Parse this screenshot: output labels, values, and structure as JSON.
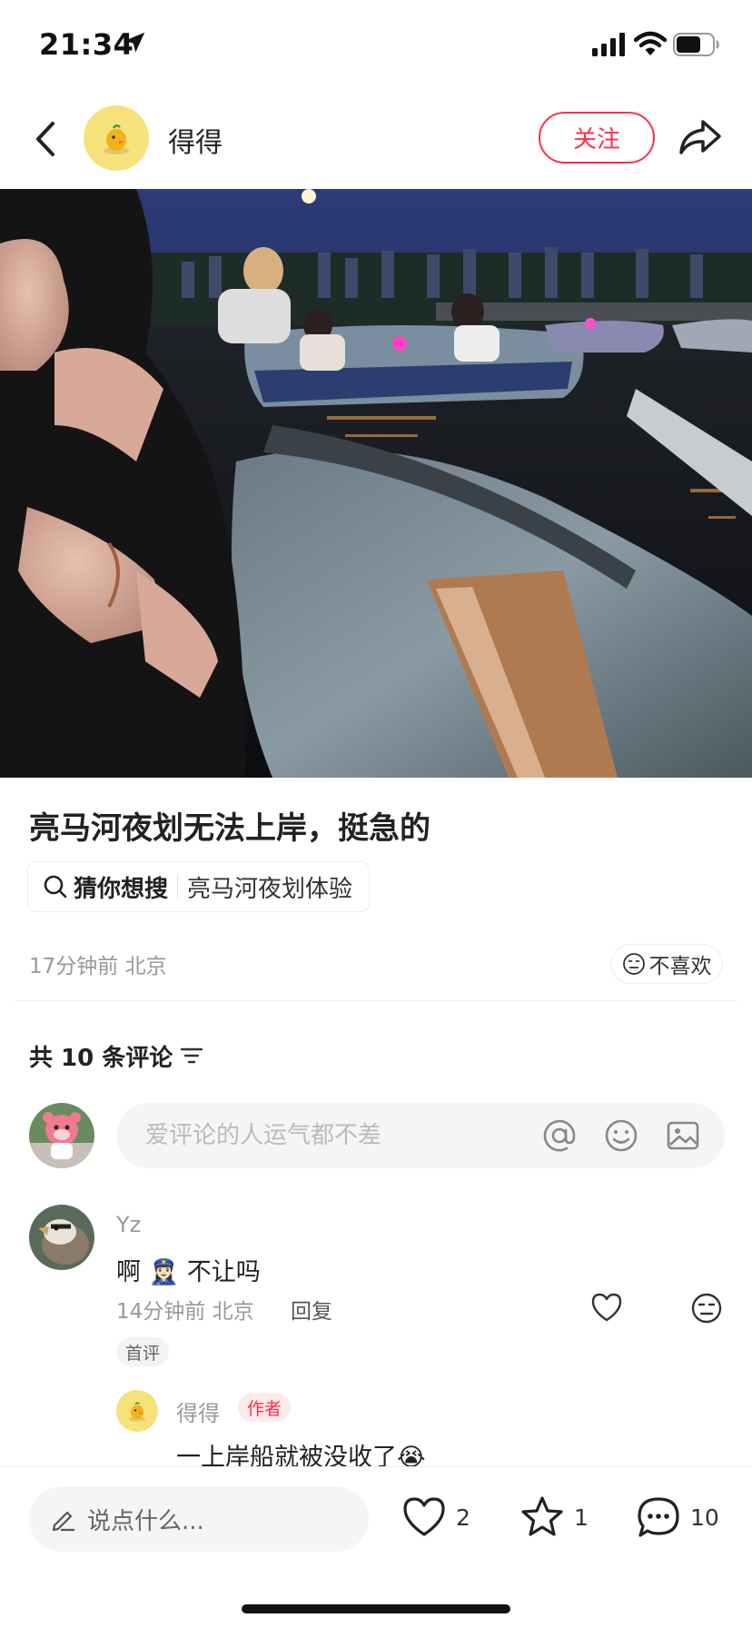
{
  "status_bar": {
    "time": "21:34"
  },
  "header": {
    "author_name": "得得",
    "follow_label": "关注"
  },
  "post": {
    "title": "亮马河夜划无法上岸，挺急的",
    "search_label": "猜你想搜",
    "search_query": "亮马河夜划体验",
    "meta": "17分钟前 北京",
    "dislike_label": "不喜欢"
  },
  "comments": {
    "count_label": "共 10 条评论",
    "input_placeholder": "爱评论的人运气都不差",
    "items": [
      {
        "user": "Yz",
        "text": "啊 👮🏻‍♀️ 不让吗",
        "meta": "14分钟前 北京",
        "reply_label": "回复",
        "badge": "首评",
        "replies": [
          {
            "user": "得得",
            "badge": "作者",
            "text": "一上岸船就被没收了😭"
          }
        ]
      }
    ]
  },
  "bottom_bar": {
    "say_placeholder": "说点什么...",
    "likes": "2",
    "stars": "1",
    "comments": "10"
  },
  "colors": {
    "accent": "#ff2e4d",
    "avatar_yellow": "#f6e27a",
    "muted": "#999999"
  }
}
